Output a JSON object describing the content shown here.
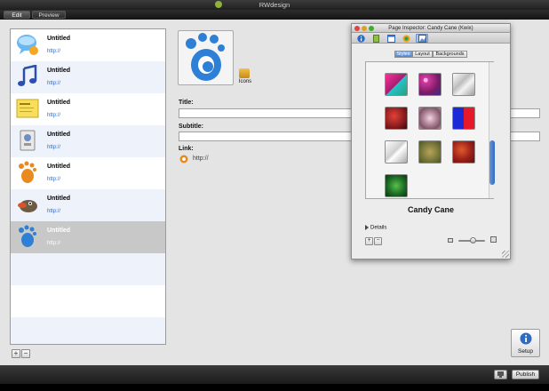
{
  "app": {
    "title": "RWdesign"
  },
  "tabs": [
    {
      "label": "Edit"
    },
    {
      "label": "Preview"
    }
  ],
  "pages": [
    {
      "title": "Untitled",
      "url": "http://",
      "icon": "ichat-bubble-icon"
    },
    {
      "title": "Untitled",
      "url": "http://",
      "icon": "music-note-icon"
    },
    {
      "title": "Untitled",
      "url": "http://",
      "icon": "sticky-note-icon"
    },
    {
      "title": "Untitled",
      "url": "http://",
      "icon": "kde-app-icon"
    },
    {
      "title": "Untitled",
      "url": "http://",
      "icon": "gimp-foot-icon"
    },
    {
      "title": "Untitled",
      "url": "http://",
      "icon": "gimp-wilber-icon"
    },
    {
      "title": "Untitled",
      "url": "http://",
      "icon": "gimp-blue-foot-icon"
    }
  ],
  "selected_page_index": 6,
  "detail": {
    "icons_label": "Icons",
    "title_label": "Title:",
    "title_value": "",
    "subtitle_label": "Subtitle:",
    "subtitle_value": "",
    "link_label": "Link:",
    "link_value": "http://"
  },
  "list_buttons": {
    "add": "+",
    "remove": "−"
  },
  "setup": {
    "label": "Setup"
  },
  "bottombar": {
    "publish_label": "Publish"
  },
  "inspector": {
    "title": "Page Inspector: Candy Cane (Kwix)",
    "segments": [
      {
        "label": "Styles"
      },
      {
        "label": "Layout"
      },
      {
        "label": "Backgrounds"
      }
    ],
    "active_segment": "Backgrounds",
    "selected_swatch_name": "Candy Cane",
    "details_label": "Details",
    "add": "+",
    "remove": "−"
  },
  "colors": {
    "link_blue": "#2f68c8",
    "selected_row": "#c8c8c8",
    "alt_row": "#eef2fb",
    "accent_blue": "#4f86d2"
  }
}
